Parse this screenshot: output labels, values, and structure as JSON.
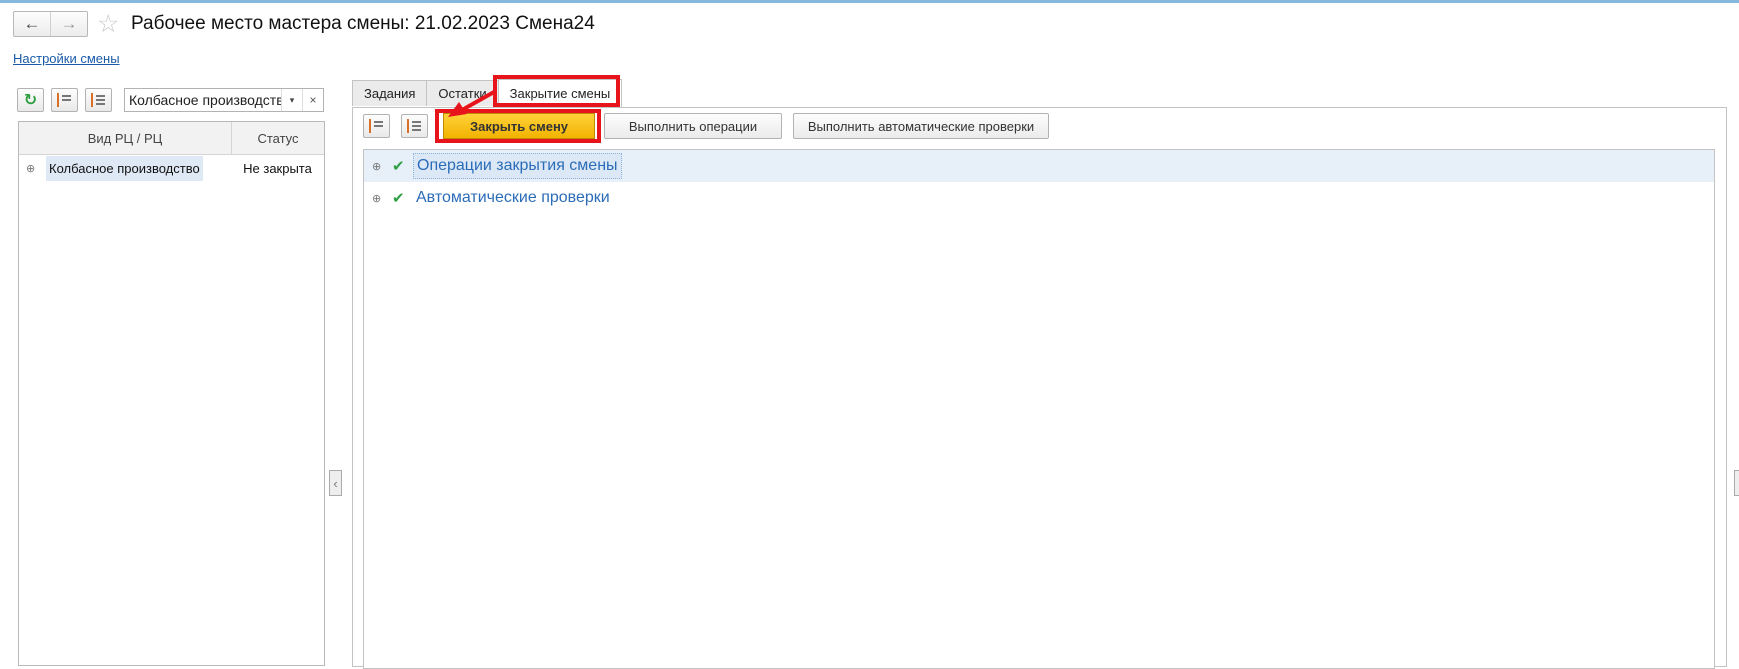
{
  "window": {
    "title": "Рабочее место мастера смены: 21.02.2023 Смена24",
    "nav_back": "←",
    "nav_forward": "→",
    "star": "☆"
  },
  "settings_link": "Настройки смены",
  "left_panel": {
    "filter_value": "Колбасное производство",
    "filter_dropdown": "▾",
    "filter_clear": "×",
    "columns": [
      "Вид РЦ / РЦ",
      "Статус"
    ],
    "rows": [
      {
        "expander": "⊕",
        "name": "Колбасное производство",
        "status": "Не закрыта"
      }
    ]
  },
  "tabs": [
    "Задания",
    "Остатки",
    "Закрытие смены"
  ],
  "active_tab": "Закрытие смены",
  "right_toolbar": {
    "close_shift": "Закрыть смену",
    "run_operations": "Выполнить операции",
    "run_auto_checks": "Выполнить автоматические проверки"
  },
  "operations": [
    {
      "expander": "⊕",
      "check": "✔",
      "label": "Операции закрытия смены",
      "selected": true
    },
    {
      "expander": "⊕",
      "check": "✔",
      "label": "Автоматические проверки",
      "selected": false
    }
  ],
  "colors": {
    "highlight": "#e8141b",
    "primary_button": "#f2b300",
    "link": "#2b6cb8",
    "check": "#2ea043"
  }
}
